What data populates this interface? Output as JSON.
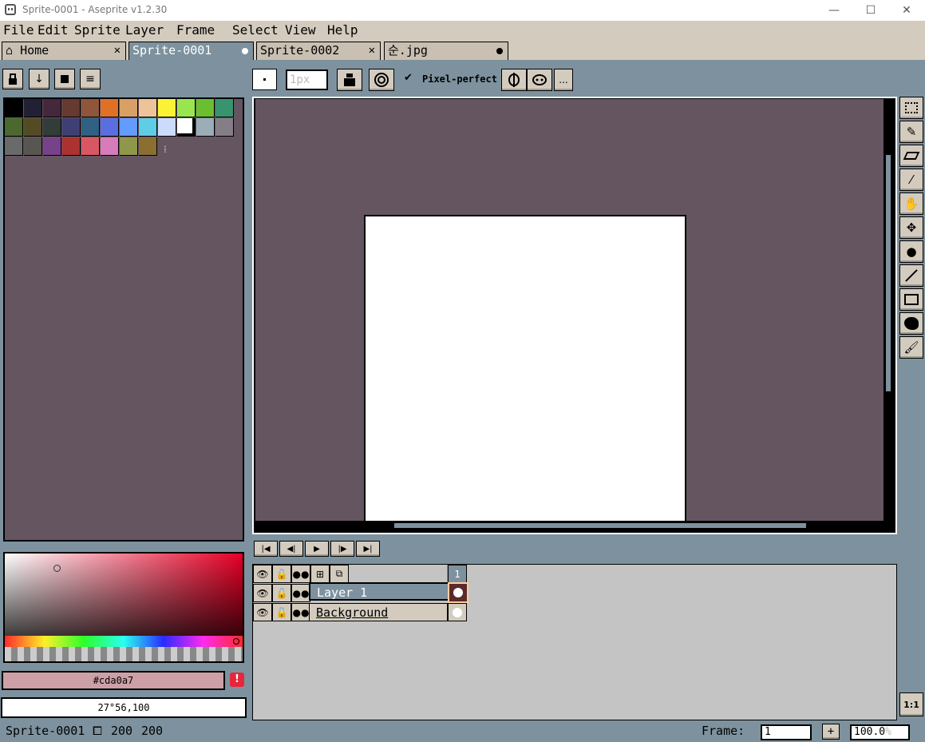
{
  "window": {
    "title": "Sprite-0001 - Aseprite v1.2.30",
    "minimize": "—",
    "maximize": "☐",
    "close": "✕"
  },
  "menu": [
    "File",
    "Edit",
    "Sprite",
    "Layer",
    "Frame",
    "Select",
    "View",
    "Help"
  ],
  "tabs": [
    {
      "label": "Home",
      "icon": "home-icon",
      "close": "✕"
    },
    {
      "label": "Sprite-0001",
      "active": true
    },
    {
      "label": "Sprite-0002",
      "close": "✕"
    },
    {
      "label": "순.jpg"
    }
  ],
  "tool_options": {
    "brush_size": "1px",
    "pixel_perfect_label": "Pixel-perfect",
    "pixel_perfect_checked": true,
    "more_label": "..."
  },
  "palette": {
    "colors": [
      "#000000",
      "#222034",
      "#45283c",
      "#663931",
      "#8f563b",
      "#df7126",
      "#d9a066",
      "#eec39a",
      "#fbf236",
      "#99e550",
      "#6abe30",
      "#37946e",
      "#4b692f",
      "#524b24",
      "#323c39",
      "#3f3f74",
      "#306082",
      "#5b6ee1",
      "#639bff",
      "#5fcde4",
      "#cbdbfc",
      "#ffffff",
      "#9badb7",
      "#847e87",
      "#696a6a",
      "#595652",
      "#76428a",
      "#ac3232",
      "#d95763",
      "#d77bba",
      "#8f974a",
      "#8a6f30"
    ],
    "more_glyph": "⁞"
  },
  "color_picker": {
    "hex": "#cda0a7",
    "hsv": "27°56,100",
    "warning_icon": "!"
  },
  "frame_controls": {
    "first": "|◀",
    "prev": "◀|",
    "play": "▶",
    "next": "|▶",
    "last": "▶|"
  },
  "timeline": {
    "frame_header": "1",
    "layers": [
      {
        "name": "Layer 1",
        "selected": true
      },
      {
        "name": "Background",
        "selected": false
      }
    ]
  },
  "status": {
    "sprite_name": "Sprite-0001",
    "width": "200",
    "height": "200",
    "frame_label": "Frame:",
    "frame_value": "1",
    "add_frame": "+",
    "zoom": "100.0",
    "zoom_unit": "%",
    "zoom_1to1": "1:1"
  }
}
